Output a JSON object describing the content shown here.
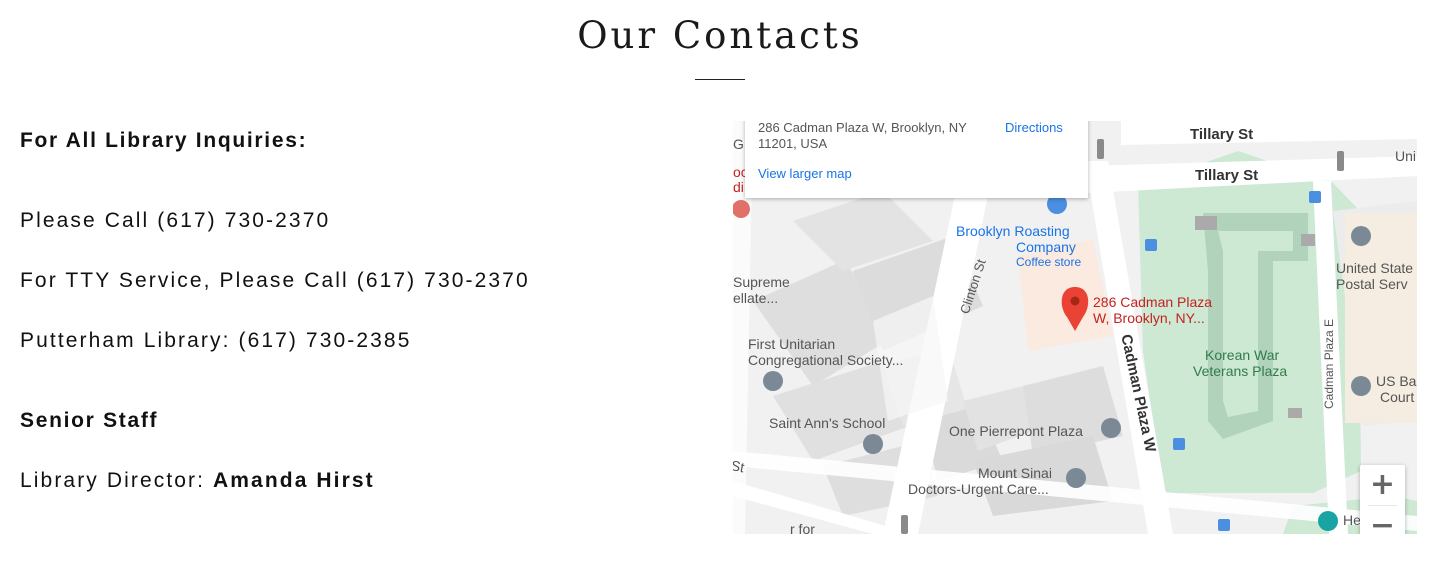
{
  "page": {
    "title": "Our Contacts"
  },
  "contacts": {
    "inquiries_heading": "For All Library Inquiries:",
    "phone_line": "Please Call (617) 730-2370",
    "tty_line": "For TTY Service, Please Call (617) 730-2370",
    "putterham_line": "Putterham Library: (617) 730-2385",
    "staff_heading": "Senior Staff",
    "director_label": "Library Director:",
    "director_name": "Amanda Hirst"
  },
  "map": {
    "info_card": {
      "address": "286 Cadman Plaza W, Brooklyn, NY 11201, USA",
      "directions_label": "Directions",
      "larger_map_label": "View larger map"
    },
    "marker_label_line1": "286 Cadman Plaza",
    "marker_label_line2": "W, Brooklyn, NY...",
    "streets": {
      "tillary_1": "Tillary St",
      "tillary_2": "Tillary St",
      "clinton": "Clinton St",
      "cadman_w": "Cadman Plaza W",
      "cadman_e": "Cadman Plaza E",
      "left_st": "St"
    },
    "places": {
      "roasting_line1": "Brooklyn Roasting",
      "roasting_line2": "Company",
      "roasting_sub": "Coffee store",
      "supreme_line1": "Supreme",
      "supreme_line2": "ellate...",
      "unitarian_line1": "First Unitarian",
      "unitarian_line2": "Congregational Society...",
      "saint_ann": "Saint Ann's School",
      "pierrepont": "One Pierrepont Plaza",
      "sinai_line1": "Mount Sinai",
      "sinai_line2": "Doctors-Urgent Care...",
      "korean_line1": "Korean War",
      "korean_line2": "Veterans Plaza",
      "postal_line1": "United State",
      "postal_line2": "Postal Serv",
      "usba_line1": "US Ba",
      "usba_line2": "Court",
      "top_right": "Uni",
      "bottom_left": "r for",
      "bottom_right": "He ar",
      "left_edge_g": "G",
      "left_edge_oc": "oc",
      "left_edge_di": "di"
    },
    "zoom_in_label": "+",
    "zoom_out_label": "−",
    "colors": {
      "park": "#cde8d3",
      "park_path": "#b2d3bb",
      "building": "#dedede",
      "road": "#ffffff",
      "marker": "#ea4335",
      "highlight": "#fbeadf"
    }
  }
}
